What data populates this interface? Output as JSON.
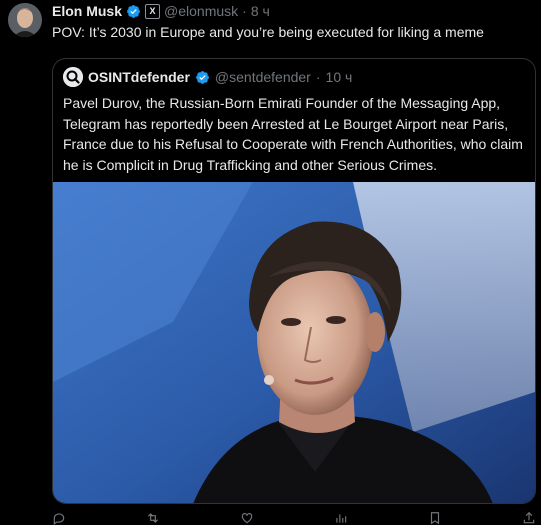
{
  "post": {
    "author_name": "Elon Musk",
    "author_handle": "@elonmusk",
    "separator": "·",
    "time": "8 ч",
    "text": "POV: It’s 2030 in Europe and you’re being executed for liking a meme",
    "badge_x": "X"
  },
  "quote": {
    "author_name": "OSINTdefender",
    "author_handle": "@sentdefender",
    "separator": "·",
    "time": "10 ч",
    "text": "Pavel Durov, the Russian-Born Emirati Founder of the Messaging App, Telegram has reportedly been Arrested at Le Bourget Airport near Paris, France due to his Refusal to Cooperate with French Authorities, who claim he is Complicit in Drug Trafficking and other Serious Crimes."
  },
  "colors": {
    "background": "#000000",
    "text": "#e7e9ea",
    "muted": "#71767b",
    "verified": "#1d9bf0",
    "border": "#2f3336"
  },
  "icons": [
    "verified-badge-icon",
    "x-affiliate-badge-icon",
    "reply-icon",
    "repost-icon",
    "like-icon",
    "views-icon",
    "bookmark-icon",
    "share-icon"
  ]
}
